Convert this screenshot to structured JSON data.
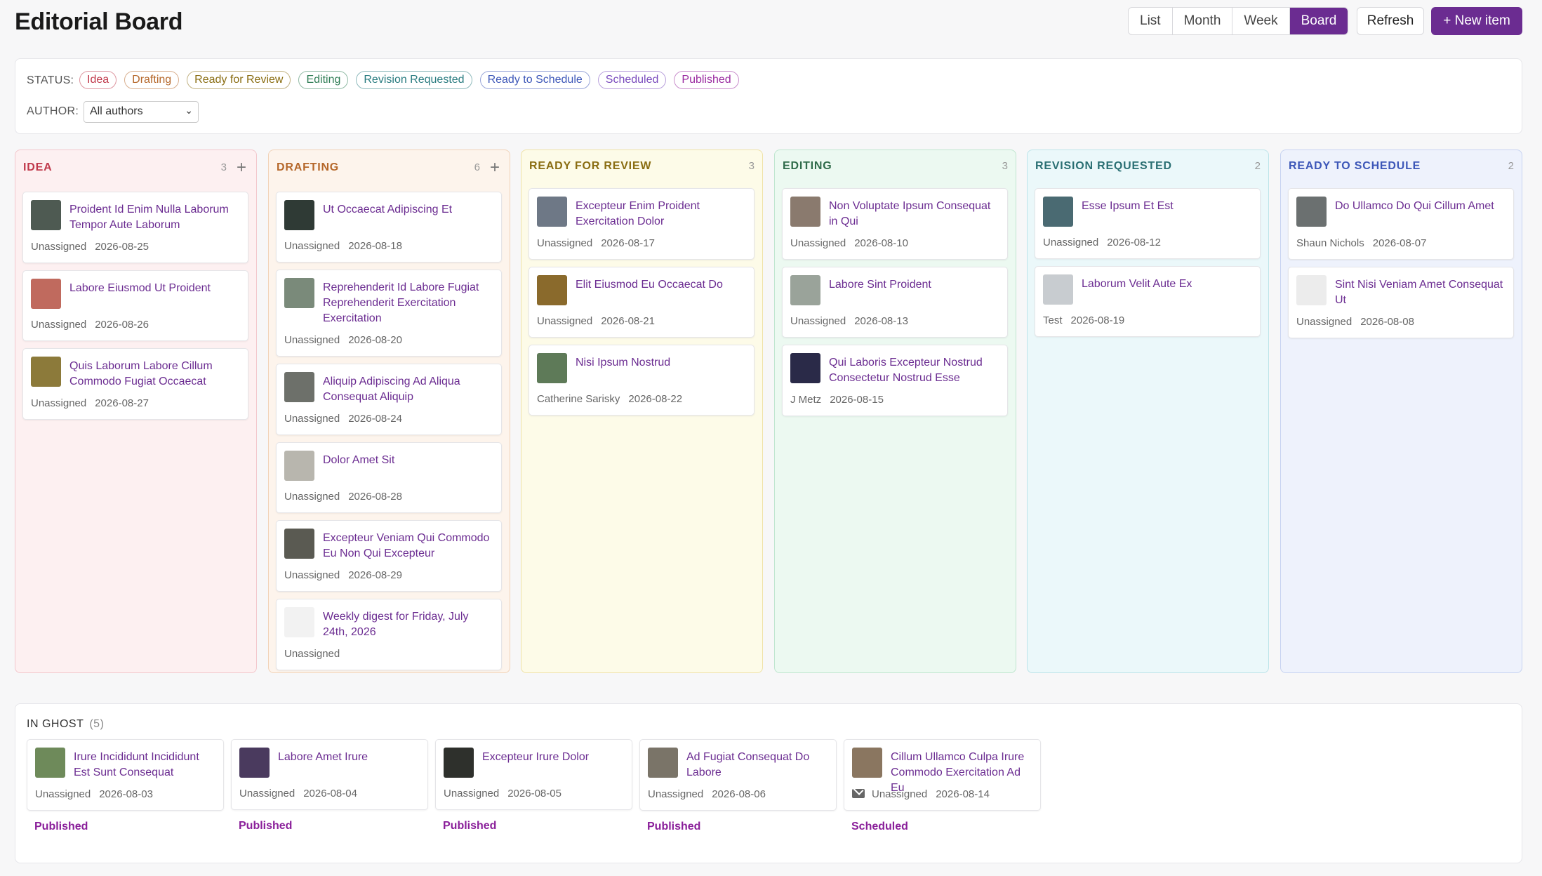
{
  "header": {
    "title": "Editorial Board",
    "views": [
      "List",
      "Month",
      "Week",
      "Board"
    ],
    "active_view": "Board",
    "refresh_label": "Refresh",
    "new_item_label": "+ New item"
  },
  "filters": {
    "status_label": "STATUS:",
    "statuses": [
      {
        "label": "Idea",
        "color": "#c0394b"
      },
      {
        "label": "Drafting",
        "color": "#b5672a"
      },
      {
        "label": "Ready for Review",
        "color": "#8a6d12"
      },
      {
        "label": "Editing",
        "color": "#2f7d55"
      },
      {
        "label": "Revision Requested",
        "color": "#2a7c80"
      },
      {
        "label": "Ready to Schedule",
        "color": "#3d57b8"
      },
      {
        "label": "Scheduled",
        "color": "#7a4bbd"
      },
      {
        "label": "Published",
        "color": "#9a2aa0"
      }
    ],
    "author_label": "AUTHOR:",
    "author_value": "All authors"
  },
  "columns": [
    {
      "title": "IDEA",
      "count": "3",
      "add": "+",
      "color": "#c0394b",
      "bg": "#fdf0f1",
      "border": "#f2c7cc",
      "cards": [
        {
          "title": "Proident Id Enim Nulla Laborum Tempor Aute Laborum",
          "author": "Unassigned",
          "date": "2026-08-25",
          "thumb": "#4e5a52"
        },
        {
          "title": "Labore Eiusmod Ut Proident",
          "author": "Unassigned",
          "date": "2026-08-26",
          "thumb": "#c06a5e"
        },
        {
          "title": "Quis Laborum Labore Cillum Commodo Fugiat Occaecat",
          "author": "Unassigned",
          "date": "2026-08-27",
          "thumb": "#8c7a3a"
        }
      ]
    },
    {
      "title": "DRAFTING",
      "count": "6",
      "add": "+",
      "color": "#b5672a",
      "bg": "#fdf4ec",
      "border": "#f1d3b8",
      "cards": [
        {
          "title": "Ut Occaecat Adipiscing Et",
          "author": "Unassigned",
          "date": "2026-08-18",
          "thumb": "#2f3a35"
        },
        {
          "title": "Reprehenderit Id Labore Fugiat Reprehenderit Exercitation Exercitation",
          "author": "Unassigned",
          "date": "2026-08-20",
          "thumb": "#7a8a7a"
        },
        {
          "title": "Aliquip Adipiscing Ad Aliqua Consequat Aliquip",
          "author": "Unassigned",
          "date": "2026-08-24",
          "thumb": "#6d706a"
        },
        {
          "title": "Dolor Amet Sit",
          "author": "Unassigned",
          "date": "2026-08-28",
          "thumb": "#b8b6ae"
        },
        {
          "title": "Excepteur Veniam Qui Commodo Eu Non Qui Excepteur",
          "author": "Unassigned",
          "date": "2026-08-29",
          "thumb": "#5a5a52"
        },
        {
          "title": "Weekly digest for Friday, July 24th, 2026",
          "author": "Unassigned",
          "date": "",
          "thumb": "#f2f2f2"
        }
      ]
    },
    {
      "title": "READY FOR REVIEW",
      "count": "3",
      "add": "",
      "color": "#8a6d12",
      "bg": "#fdfbe8",
      "border": "#efe2a8",
      "cards": [
        {
          "title": "Excepteur Enim Proident Exercitation Dolor",
          "author": "Unassigned",
          "date": "2026-08-17",
          "thumb": "#6e7886"
        },
        {
          "title": "Elit Eiusmod Eu Occaecat Do",
          "author": "Unassigned",
          "date": "2026-08-21",
          "thumb": "#8a6a2c"
        },
        {
          "title": "Nisi Ipsum Nostrud",
          "author": "Catherine Sarisky",
          "date": "2026-08-22",
          "thumb": "#5e7a58"
        }
      ]
    },
    {
      "title": "EDITING",
      "count": "3",
      "add": "",
      "color": "#2f6b4a",
      "bg": "#ecf9f1",
      "border": "#bfe6cf",
      "cards": [
        {
          "title": "Non Voluptate Ipsum Consequat in Qui",
          "author": "Unassigned",
          "date": "2026-08-10",
          "thumb": "#8a7a6e"
        },
        {
          "title": "Labore Sint Proident",
          "author": "Unassigned",
          "date": "2026-08-13",
          "thumb": "#9aa39a"
        },
        {
          "title": "Qui Laboris Excepteur Nostrud Consectetur Nostrud Esse",
          "author": "J Metz",
          "date": "2026-08-15",
          "thumb": "#2a2a48"
        }
      ]
    },
    {
      "title": "REVISION REQUESTED",
      "count": "2",
      "add": "",
      "color": "#2a6f73",
      "bg": "#ebf8fa",
      "border": "#bde4e9",
      "cards": [
        {
          "title": "Esse Ipsum Et Est",
          "author": "Unassigned",
          "date": "2026-08-12",
          "thumb": "#4a6a72"
        },
        {
          "title": "Laborum Velit Aute Ex",
          "author": "Test",
          "date": "2026-08-19",
          "thumb": "#c8ccd0"
        }
      ]
    },
    {
      "title": "READY TO SCHEDULE",
      "count": "2",
      "add": "",
      "color": "#3d57b8",
      "bg": "#eef2fc",
      "border": "#c7d3f1",
      "cards": [
        {
          "title": "Do Ullamco Do Qui Cillum Amet",
          "author": "Shaun Nichols",
          "date": "2026-08-07",
          "thumb": "#6b7070"
        },
        {
          "title": "Sint Nisi Veniam Amet Consequat Ut",
          "author": "Unassigned",
          "date": "2026-08-08",
          "thumb": "#ececec"
        }
      ]
    }
  ],
  "ghost": {
    "title": "IN GHOST",
    "count": "(5)",
    "cards": [
      {
        "title": "Irure Incididunt Incididunt Est Sunt Consequat",
        "author": "Unassigned",
        "date": "2026-08-03",
        "status": "Published",
        "thumb": "#6e8a5a",
        "icon": ""
      },
      {
        "title": "Labore Amet Irure",
        "author": "Unassigned",
        "date": "2026-08-04",
        "status": "Published",
        "thumb": "#4a3a5e",
        "icon": ""
      },
      {
        "title": "Excepteur Irure Dolor",
        "author": "Unassigned",
        "date": "2026-08-05",
        "status": "Published",
        "thumb": "#2e302c",
        "icon": ""
      },
      {
        "title": "Ad Fugiat Consequat Do Labore",
        "author": "Unassigned",
        "date": "2026-08-06",
        "status": "Published",
        "thumb": "#7a7468",
        "icon": ""
      },
      {
        "title": "Cillum Ullamco Culpa Irure Commodo Exercitation Ad Eu",
        "author": "Unassigned",
        "date": "2026-08-14",
        "status": "Scheduled",
        "thumb": "#8a7660",
        "icon": "mail-icon"
      }
    ]
  }
}
